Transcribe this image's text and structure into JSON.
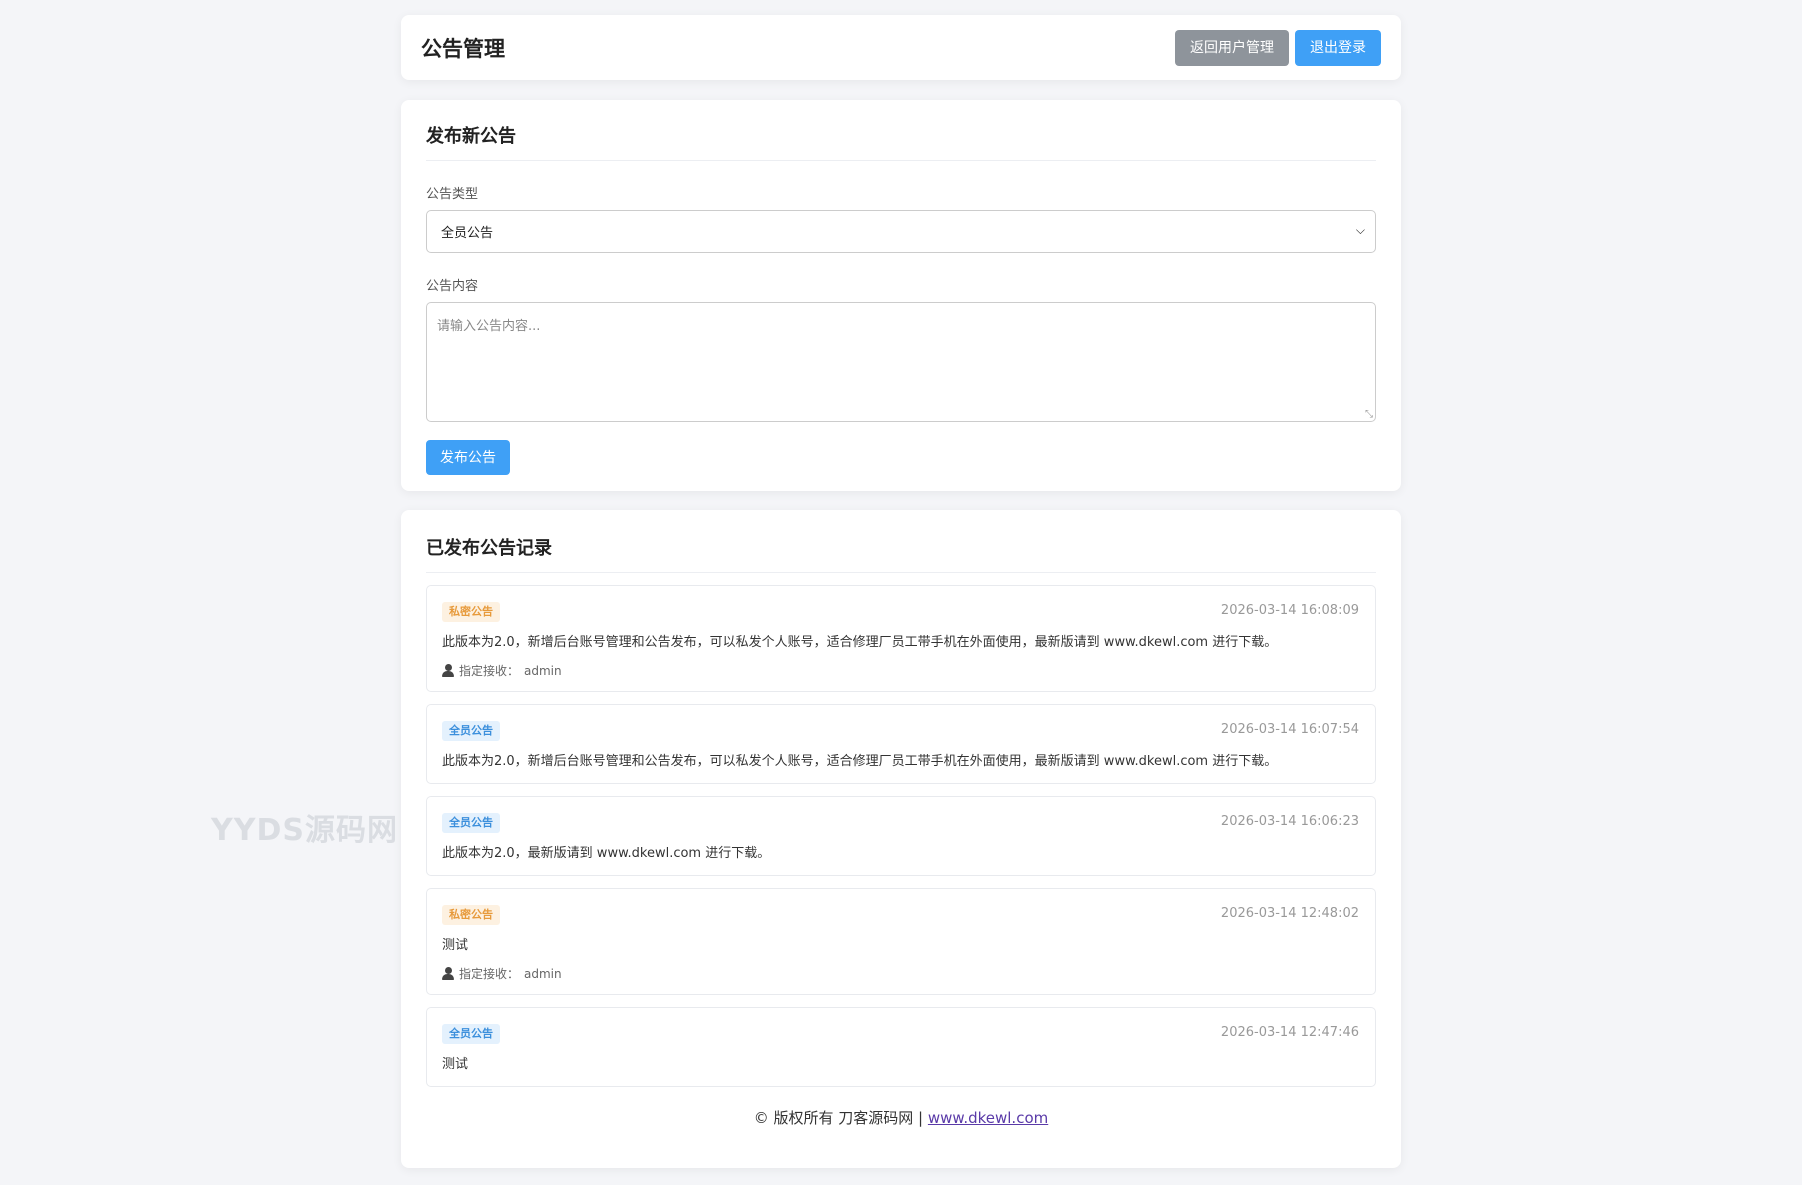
{
  "header": {
    "title": "公告管理",
    "back_label": "返回用户管理",
    "logout_label": "退出登录"
  },
  "publish": {
    "section_title": "发布新公告",
    "type_label": "公告类型",
    "type_value": "全员公告",
    "content_label": "公告内容",
    "content_placeholder": "请输入公告内容...",
    "submit_label": "发布公告"
  },
  "records": {
    "section_title": "已发布公告记录",
    "recipient_prefix": "指定接收：",
    "items": [
      {
        "type": "私密公告",
        "time": "2026-03-14 16:08:09",
        "content": "此版本为2.0，新增后台账号管理和公告发布，可以私发个人账号，适合修理厂员工带手机在外面使用，最新版请到 www.dkewl.com 进行下载。",
        "recipient": "admin"
      },
      {
        "type": "全员公告",
        "time": "2026-03-14 16:07:54",
        "content": "此版本为2.0，新增后台账号管理和公告发布，可以私发个人账号，适合修理厂员工带手机在外面使用，最新版请到 www.dkewl.com 进行下载。"
      },
      {
        "type": "全员公告",
        "time": "2026-03-14 16:06:23",
        "content": "此版本为2.0，最新版请到 www.dkewl.com 进行下载。"
      },
      {
        "type": "私密公告",
        "time": "2026-03-14 12:48:02",
        "content": "测试",
        "recipient": "admin"
      },
      {
        "type": "全员公告",
        "time": "2026-03-14 12:47:46",
        "content": "测试"
      }
    ]
  },
  "footer": {
    "text": "© 版权所有 刀客源码网 | ",
    "link": "www.dkewl.com"
  },
  "watermark": "YYDS源码网",
  "colors": {
    "primary": "#3fa0f6",
    "secondary": "#8e949b",
    "private_badge": "#e79a3b",
    "all_badge": "#3b8fdc"
  }
}
